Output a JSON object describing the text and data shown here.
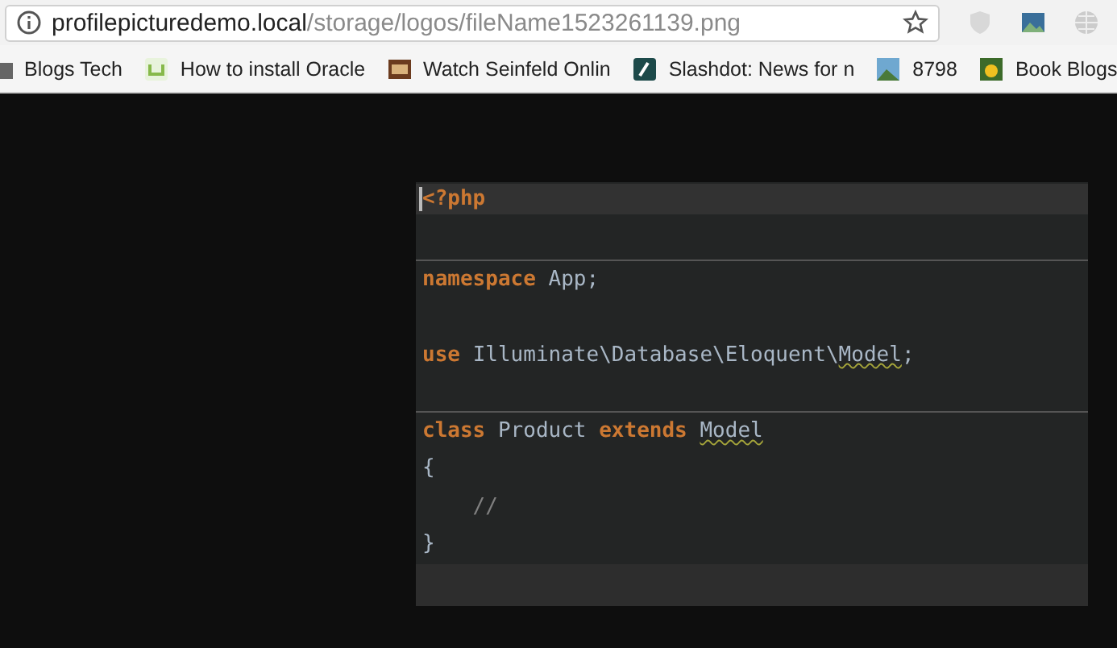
{
  "address_bar": {
    "host": "profilepicturedemo.local",
    "path": "/storage/logos/fileName1523261139.png"
  },
  "bookmarks": [
    {
      "label": "Blogs Tech"
    },
    {
      "label": "How to install Oracle"
    },
    {
      "label": "Watch Seinfeld Onlin"
    },
    {
      "label": "Slashdot: News for n"
    },
    {
      "label": "8798"
    },
    {
      "label": "Book Blogs"
    }
  ],
  "code_image": {
    "lines": [
      {
        "current": true,
        "separator_above": false,
        "tokens": [
          {
            "text": "<?php",
            "kind": "keyword"
          }
        ]
      },
      {
        "current": false,
        "separator_above": false
      },
      {
        "current": false,
        "separator_above": true,
        "tokens": [
          {
            "text": "namespace ",
            "kind": "keyword"
          },
          {
            "text": "App;",
            "kind": "ident"
          }
        ]
      },
      {
        "current": false,
        "separator_above": false
      },
      {
        "current": false,
        "separator_above": false,
        "tokens": [
          {
            "text": "use ",
            "kind": "keyword"
          },
          {
            "text": "Illuminate\\Database\\Eloquent\\",
            "kind": "ident"
          },
          {
            "text": "Model",
            "kind": "ident",
            "underlined": true
          },
          {
            "text": ";",
            "kind": "ident"
          }
        ]
      },
      {
        "current": false,
        "separator_above": false
      },
      {
        "current": false,
        "separator_above": true,
        "tokens": [
          {
            "text": "class",
            "kind": "keyword"
          },
          {
            "text": " Product ",
            "kind": "ident"
          },
          {
            "text": "extends ",
            "kind": "keyword"
          },
          {
            "text": "Model",
            "kind": "ident",
            "underlined": true
          }
        ]
      },
      {
        "current": false,
        "separator_above": false,
        "tokens": [
          {
            "text": "{",
            "kind": "ident"
          }
        ]
      },
      {
        "current": false,
        "separator_above": false,
        "tokens": [
          {
            "text": "    //",
            "kind": "comment"
          }
        ]
      },
      {
        "current": false,
        "separator_above": false,
        "tokens": [
          {
            "text": "}",
            "kind": "ident"
          }
        ]
      }
    ]
  }
}
